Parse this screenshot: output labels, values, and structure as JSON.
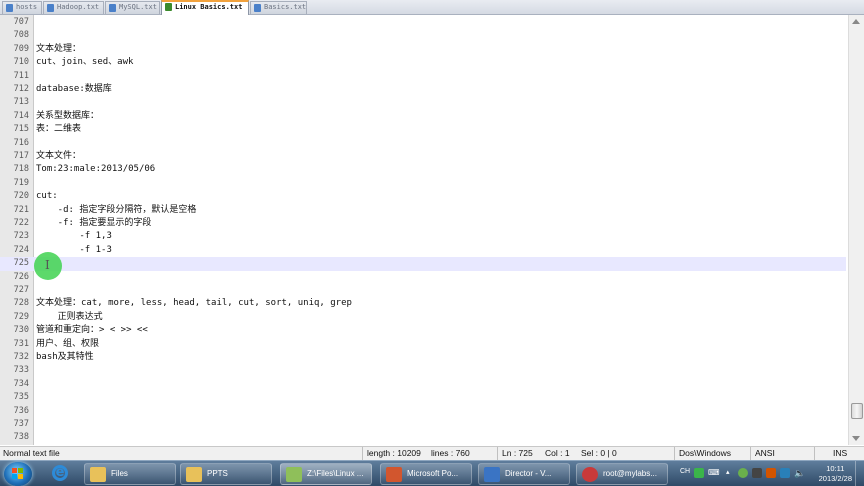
{
  "tabs": [
    {
      "label": "hosts"
    },
    {
      "label": "Hadoop.txt"
    },
    {
      "label": "MySQL.txt"
    },
    {
      "label": "Linux Basics.txt",
      "active": true
    },
    {
      "label": "Basics.txt"
    }
  ],
  "editor": {
    "current_line": "725",
    "lines": [
      {
        "num": "707",
        "text": ""
      },
      {
        "num": "708",
        "text": ""
      },
      {
        "num": "709",
        "text": "文本处理："
      },
      {
        "num": "710",
        "text": "cut、join、sed、awk"
      },
      {
        "num": "711",
        "text": ""
      },
      {
        "num": "712",
        "text": "database:数据库"
      },
      {
        "num": "713",
        "text": ""
      },
      {
        "num": "714",
        "text": "关系型数据库："
      },
      {
        "num": "715",
        "text": "表：二维表"
      },
      {
        "num": "716",
        "text": ""
      },
      {
        "num": "717",
        "text": "文本文件："
      },
      {
        "num": "718",
        "text": "Tom:23:male:2013/05/06"
      },
      {
        "num": "719",
        "text": ""
      },
      {
        "num": "720",
        "text": "cut:"
      },
      {
        "num": "721",
        "text": "    -d: 指定字段分隔符，默认是空格"
      },
      {
        "num": "722",
        "text": "    -f: 指定要显示的字段"
      },
      {
        "num": "723",
        "text": "        -f 1,3"
      },
      {
        "num": "724",
        "text": "        -f 1-3"
      },
      {
        "num": "725",
        "text": ""
      },
      {
        "num": "726",
        "text": ""
      },
      {
        "num": "727",
        "text": ""
      },
      {
        "num": "728",
        "text": "文本处理：cat, more, less, head, tail, cut, sort, uniq, grep"
      },
      {
        "num": "729",
        "text": "    正则表达式"
      },
      {
        "num": "730",
        "text": "管道和重定向：> < >> <<"
      },
      {
        "num": "731",
        "text": "用户、组、权限"
      },
      {
        "num": "732",
        "text": "bash及其特性"
      },
      {
        "num": "733",
        "text": ""
      },
      {
        "num": "734",
        "text": ""
      },
      {
        "num": "735",
        "text": ""
      },
      {
        "num": "736",
        "text": ""
      },
      {
        "num": "737",
        "text": ""
      },
      {
        "num": "738",
        "text": ""
      }
    ],
    "mouse_cursor_glyph": "I"
  },
  "statusbar": {
    "file_type": "Normal text file",
    "length": "length : 10209",
    "lines": "lines : 760",
    "ln": "Ln : 725",
    "col": "Col : 1",
    "sel": "Sel : 0 | 0",
    "eol": "Dos\\Windows",
    "encoding": "ANSI",
    "mode": "INS"
  },
  "taskbar": {
    "items": [
      {
        "label": "Files",
        "icon": "folder-icon",
        "color": "#e8c15a"
      },
      {
        "label": "PPTS",
        "icon": "folder-icon",
        "color": "#e8c15a"
      },
      {
        "label": "Z:\\Files\\Linux ...",
        "icon": "notepad-plus-plus-icon",
        "color": "#8fbf5a"
      },
      {
        "label": "Microsoft Po...",
        "icon": "powerpoint-icon",
        "color": "#d2562e"
      },
      {
        "label": "Director - V...",
        "icon": "director-icon",
        "color": "#3a74c4"
      },
      {
        "label": "root@mylabs...",
        "icon": "terminal-icon",
        "color": "#c93a3a"
      }
    ],
    "tray": {
      "ime": "CH",
      "time": "10:11",
      "date": "2013/2/28"
    }
  }
}
